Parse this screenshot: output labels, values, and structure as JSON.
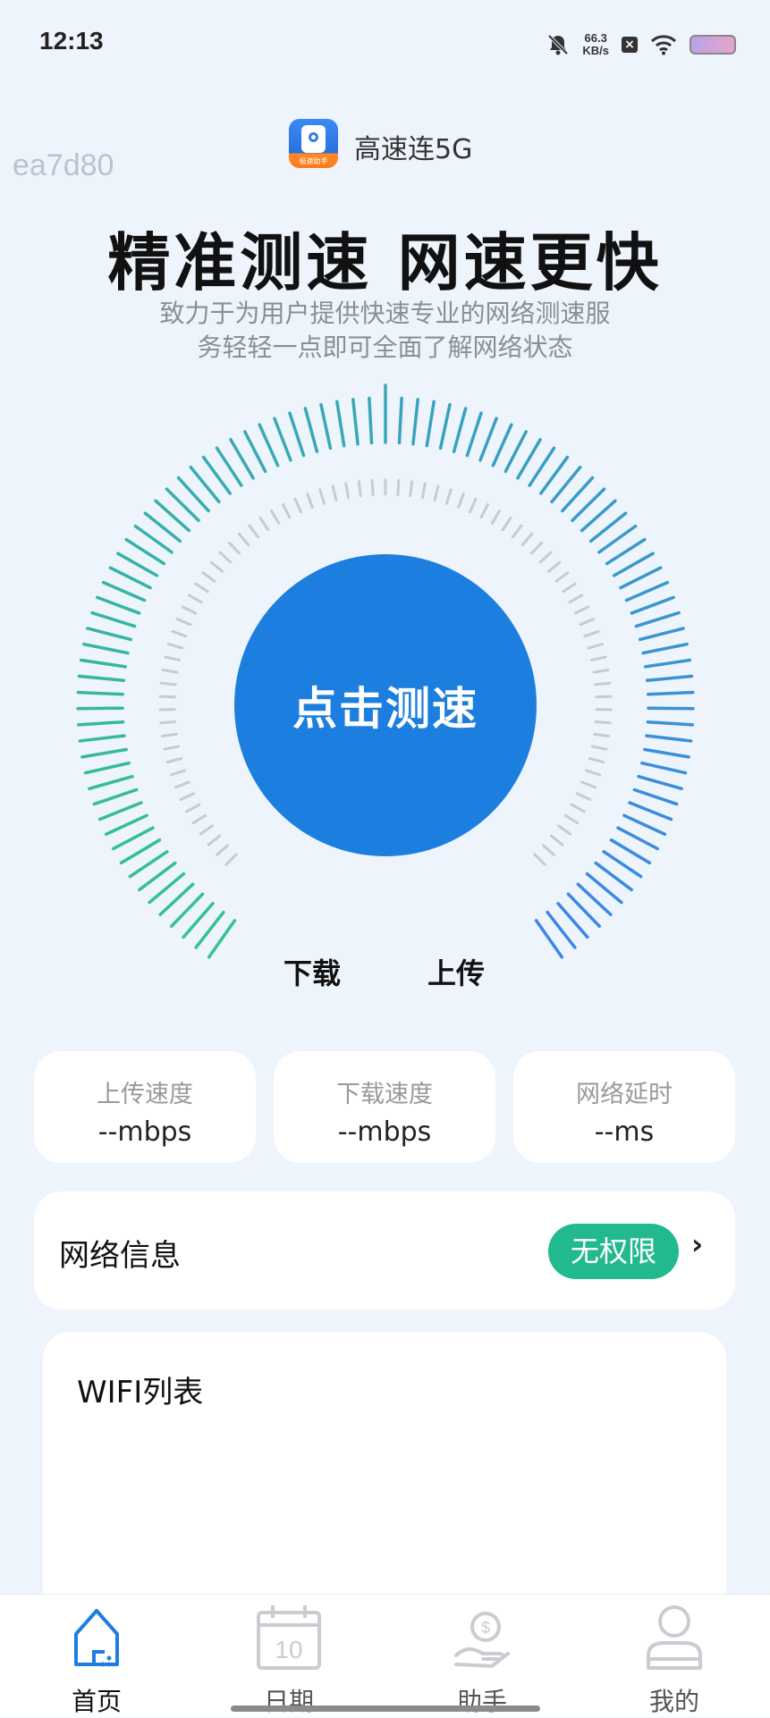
{
  "status_bar": {
    "time": "12:13",
    "net_speed_value": "66.3",
    "net_speed_unit": "KB/s"
  },
  "header": {
    "app_name": "高速连5G",
    "watermark": "ea7d80",
    "headline": "精准测速 网速更快",
    "subtitle_line1": "致力于为用户提供快速专业的网络测速服",
    "subtitle_line2": "务轻轻一点即可全面了解网络状态",
    "logo_caption": "极速助手"
  },
  "gauge": {
    "button_label": "点击测速",
    "download_label": "下载",
    "upload_label": "上传",
    "colors": {
      "green": "#34c48e",
      "blue": "#3c86e6",
      "inner_tick": "#c6ccd4",
      "button": "#1c7fe0"
    }
  },
  "stats": [
    {
      "title": "上传速度",
      "value": "--mbps"
    },
    {
      "title": "下载速度",
      "value": "--mbps"
    },
    {
      "title": "网络延时",
      "value": "--ms"
    }
  ],
  "network_info": {
    "title": "网络信息",
    "badge": "无权限",
    "badge_color": "#22b98f"
  },
  "wifi_list": {
    "title": "WIFI列表"
  },
  "tabbar": {
    "tabs": [
      {
        "label": "首页",
        "icon": "home-icon"
      },
      {
        "label": "日期",
        "icon": "calendar-icon",
        "day": "10"
      },
      {
        "label": "助手",
        "icon": "money-hand-icon"
      },
      {
        "label": "我的",
        "icon": "person-icon"
      }
    ]
  }
}
